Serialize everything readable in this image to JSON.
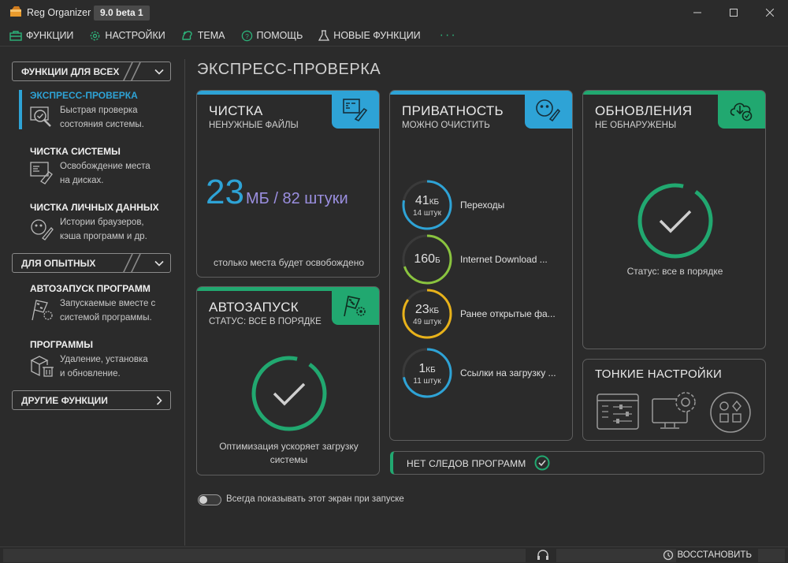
{
  "window": {
    "app_title": "Reg Organizer",
    "version": "9.0 beta 1"
  },
  "menu": {
    "items": [
      {
        "label": "ФУНКЦИИ",
        "icon": "toolbox-icon"
      },
      {
        "label": "НАСТРОЙКИ",
        "icon": "gear-icon"
      },
      {
        "label": "ТЕМА",
        "icon": "palette-icon"
      },
      {
        "label": "ПОМОЩЬ",
        "icon": "help-icon"
      },
      {
        "label": "НОВЫЕ ФУНКЦИИ",
        "icon": "flask-icon"
      }
    ],
    "more": "···"
  },
  "sidebar": {
    "section1": "ФУНКЦИИ ДЛЯ ВСЕХ",
    "section2": "ДЛЯ ОПЫТНЫХ",
    "section3": "ДРУГИЕ ФУНКЦИИ",
    "items": [
      {
        "title": "ЭКСПРЕСС-ПРОВЕРКА",
        "desc1": "Быстрая проверка",
        "desc2": "состояния системы."
      },
      {
        "title": "ЧИСТКА СИСТЕМЫ",
        "desc1": "Освобождение места",
        "desc2": "на дисках."
      },
      {
        "title": "ЧИСТКА ЛИЧНЫХ ДАННЫХ",
        "desc1": "Истории браузеров,",
        "desc2": "кэша программ и др."
      },
      {
        "title": "АВТОЗАПУСК ПРОГРАММ",
        "desc1": "Запускаемые вместе с",
        "desc2": "системой программы."
      },
      {
        "title": "ПРОГРАММЫ",
        "desc1": "Удаление, установка",
        "desc2": "и обновление."
      }
    ]
  },
  "main": {
    "page_title": "ЭКСПРЕСС-ПРОВЕРКА",
    "cleaning": {
      "title": "ЧИСТКА",
      "subtitle": "НЕНУЖНЫЕ ФАЙЛЫ",
      "size_value": "23",
      "size_rest": "МБ / 82 штуки",
      "footer": "столько места будет освобождено"
    },
    "autorun": {
      "title": "АВТОЗАПУСК",
      "subtitle": "СТАТУС: ВСЕ В ПОРЯДКЕ",
      "footer1": "Оптимизация ускоряет загрузку",
      "footer2": "системы"
    },
    "privacy": {
      "title": "ПРИВАТНОСТЬ",
      "subtitle": "МОЖНО ОЧИСТИТЬ",
      "rows": [
        {
          "value": "41",
          "unit": "КБ",
          "count": "14 штук",
          "label": "Переходы",
          "color": "#2ea3d6",
          "fraction": 0.78
        },
        {
          "value": "160",
          "unit": "Б",
          "count": "",
          "label": "Internet Download ...",
          "color": "#8ac43f",
          "fraction": 0.7
        },
        {
          "value": "23",
          "unit": "КБ",
          "count": "49 штук",
          "label": "Ранее открытые фа...",
          "color": "#e8b21a",
          "fraction": 0.85
        },
        {
          "value": "1",
          "unit": "КБ",
          "count": "11 штук",
          "label": "Ссылки на загрузку ...",
          "color": "#2ea3d6",
          "fraction": 0.72
        }
      ]
    },
    "updates": {
      "title": "ОБНОВЛЕНИЯ",
      "subtitle": "НЕ ОБНАРУЖЕНЫ",
      "status": "Статус: все в порядке"
    },
    "tweaks": {
      "title": "ТОНКИЕ НАСТРОЙКИ"
    },
    "no_traces": "НЕТ СЛЕДОВ ПРОГРАММ",
    "always_show": "Всегда показывать этот экран при запуске"
  },
  "statusbar": {
    "restore": "ВОССТАНОВИТЬ"
  },
  "colors": {
    "accent_blue": "#2ea3d6",
    "accent_green": "#21a870",
    "purple_text": "#9b8fe0"
  }
}
